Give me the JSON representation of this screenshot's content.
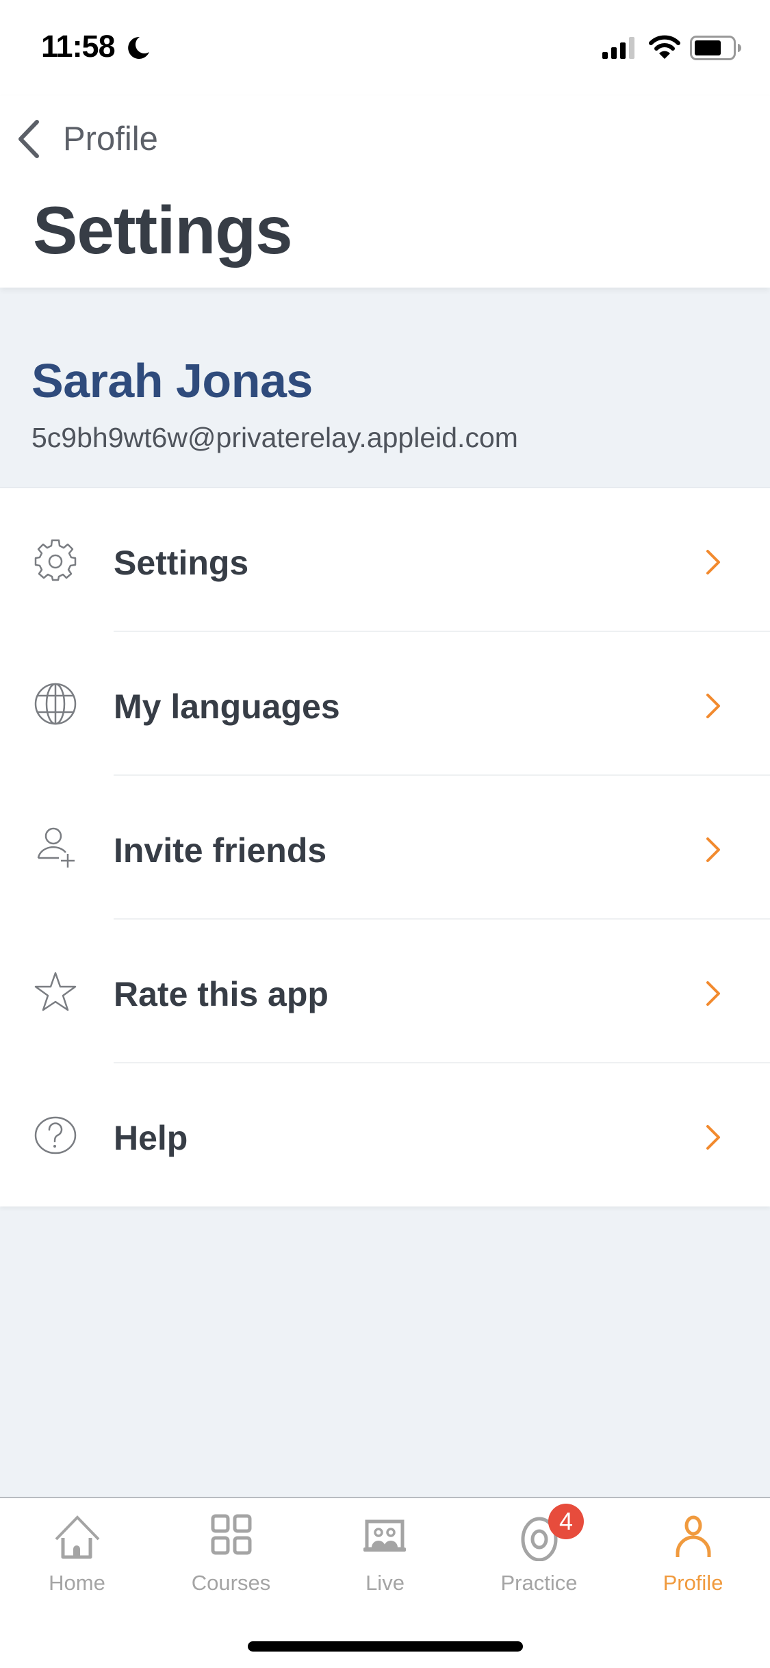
{
  "status_bar": {
    "time": "11:58",
    "focus_mode_icon": "moon-icon",
    "signal_icon": "cellular-signal-icon",
    "wifi_icon": "wifi-icon",
    "battery_icon": "battery-icon"
  },
  "header": {
    "back_label": "Profile",
    "title": "Settings"
  },
  "profile": {
    "name": "Sarah Jonas",
    "email": "5c9bh9wt6w@privaterelay.appleid.com"
  },
  "menu": {
    "items": [
      {
        "label": "Settings",
        "icon": "gear-icon"
      },
      {
        "label": "My languages",
        "icon": "globe-icon"
      },
      {
        "label": "Invite friends",
        "icon": "add-user-icon"
      },
      {
        "label": "Rate this app",
        "icon": "star-icon"
      },
      {
        "label": "Help",
        "icon": "help-circle-icon"
      }
    ]
  },
  "tab_bar": {
    "tabs": [
      {
        "label": "Home",
        "icon": "home-icon"
      },
      {
        "label": "Courses",
        "icon": "grid-icon"
      },
      {
        "label": "Live",
        "icon": "live-class-icon"
      },
      {
        "label": "Practice",
        "icon": "target-icon",
        "badge": "4"
      },
      {
        "label": "Profile",
        "icon": "person-icon",
        "active": true
      }
    ]
  },
  "colors": {
    "accent": "#f09a3e",
    "chevron": "#f28a2e",
    "name": "#2f4b7c",
    "badge": "#e74c3c",
    "background": "#eef2f6"
  }
}
